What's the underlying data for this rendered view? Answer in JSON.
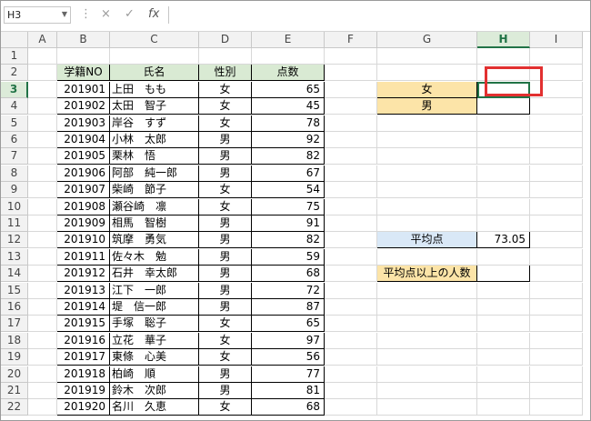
{
  "formula_bar": {
    "name_box": "H3",
    "cancel_icon": "×",
    "enter_icon": "✓",
    "fx_label": "fx",
    "formula": ""
  },
  "columns": [
    "A",
    "B",
    "C",
    "D",
    "E",
    "F",
    "G",
    "H",
    "I"
  ],
  "selected_column": "H",
  "selected_row": "3",
  "rows": [
    "1",
    "2",
    "3",
    "4",
    "5",
    "6",
    "7",
    "8",
    "9",
    "10",
    "11",
    "12",
    "13",
    "14",
    "15",
    "16",
    "17",
    "18",
    "19",
    "20",
    "21",
    "22"
  ],
  "table": {
    "headers": [
      "学籍NO",
      "氏名",
      "性別",
      "点数"
    ],
    "records": [
      [
        "201901",
        "上田　もも",
        "女",
        "65"
      ],
      [
        "201902",
        "太田　智子",
        "女",
        "45"
      ],
      [
        "201903",
        "岸谷　すず",
        "女",
        "78"
      ],
      [
        "201904",
        "小林　太郎",
        "男",
        "92"
      ],
      [
        "201905",
        "栗林　悟",
        "男",
        "82"
      ],
      [
        "201906",
        "阿部　純一郎",
        "男",
        "67"
      ],
      [
        "201907",
        "柴崎　節子",
        "女",
        "54"
      ],
      [
        "201908",
        "瀬谷崎　凛",
        "女",
        "75"
      ],
      [
        "201909",
        "相馬　智樹",
        "男",
        "91"
      ],
      [
        "201910",
        "筑摩　勇気",
        "男",
        "82"
      ],
      [
        "201911",
        "佐々木　勉",
        "男",
        "59"
      ],
      [
        "201912",
        "石井　幸太郎",
        "男",
        "68"
      ],
      [
        "201913",
        "江下　一郎",
        "男",
        "72"
      ],
      [
        "201914",
        "堤　信一郎",
        "男",
        "87"
      ],
      [
        "201915",
        "手塚　聡子",
        "女",
        "65"
      ],
      [
        "201916",
        "立花　華子",
        "女",
        "97"
      ],
      [
        "201917",
        "東條　心美",
        "女",
        "56"
      ],
      [
        "201918",
        "柏崎　順",
        "男",
        "77"
      ],
      [
        "201919",
        "鈴木　次郎",
        "男",
        "81"
      ],
      [
        "201920",
        "名川　久恵",
        "女",
        "68"
      ]
    ]
  },
  "summary": {
    "female_label": "女",
    "female_value": "",
    "male_label": "男",
    "male_value": "",
    "avg_label": "平均点",
    "avg_value": "73.05",
    "above_avg_label": "平均点以上の人数",
    "above_avg_value": ""
  },
  "colors": {
    "header_fill": "#d9ead3",
    "orange_fill": "#fce4a8",
    "blue_fill": "#d9e8f7",
    "highlight_box": "#e23030",
    "selection": "#217346"
  }
}
